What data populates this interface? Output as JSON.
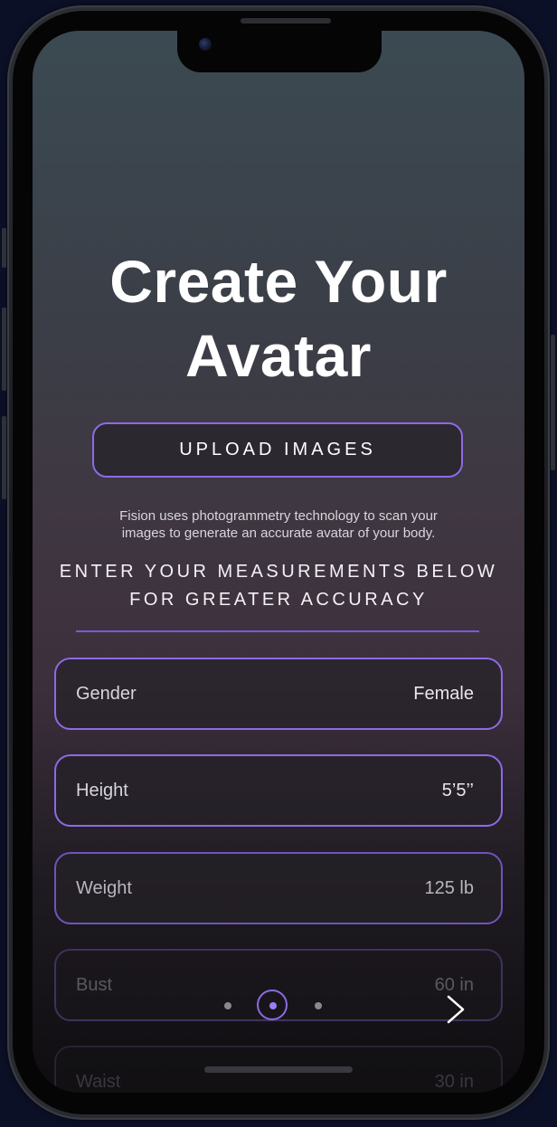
{
  "screen": {
    "title_line1": "Create Your",
    "title_line2": "Avatar",
    "upload_button_label": "UPLOAD IMAGES",
    "description_line1": "Fision uses photogrammetry technology to scan your",
    "description_line2": "images to generate an accurate avatar of your body.",
    "measurements_heading_line1": "ENTER YOUR MEASUREMENTS BELOW",
    "measurements_heading_line2": "FOR GREATER ACCURACY"
  },
  "fields": [
    {
      "label": "Gender",
      "value": "Female"
    },
    {
      "label": "Height",
      "value": "5’5’’"
    },
    {
      "label": "Weight",
      "value": "125 lb"
    },
    {
      "label": "Bust",
      "value": "60 in"
    },
    {
      "label": "Waist",
      "value": "30 in"
    }
  ],
  "pagination": {
    "total_pages": 3,
    "current_page": 2
  },
  "colors": {
    "accent": "#8e6ae6",
    "text": "#ffffff"
  },
  "icons": {
    "next": "chevron-right-icon"
  }
}
